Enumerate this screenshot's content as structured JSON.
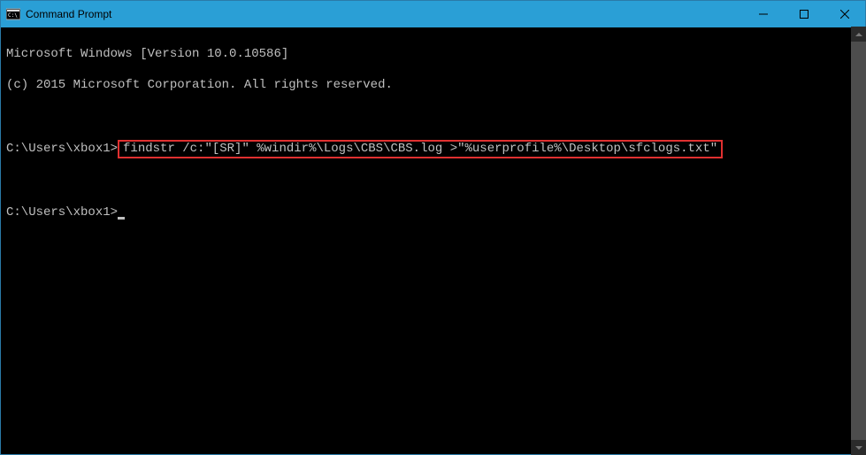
{
  "window": {
    "title": "Command Prompt"
  },
  "terminal": {
    "line1": "Microsoft Windows [Version 10.0.10586]",
    "line2": "(c) 2015 Microsoft Corporation. All rights reserved.",
    "prompt1_prefix": "C:\\Users\\xbox1>",
    "command": "findstr /c:\"[SR]\" %windir%\\Logs\\CBS\\CBS.log >\"%userprofile%\\Desktop\\sfclogs.txt\"",
    "prompt2": "C:\\Users\\xbox1>"
  }
}
